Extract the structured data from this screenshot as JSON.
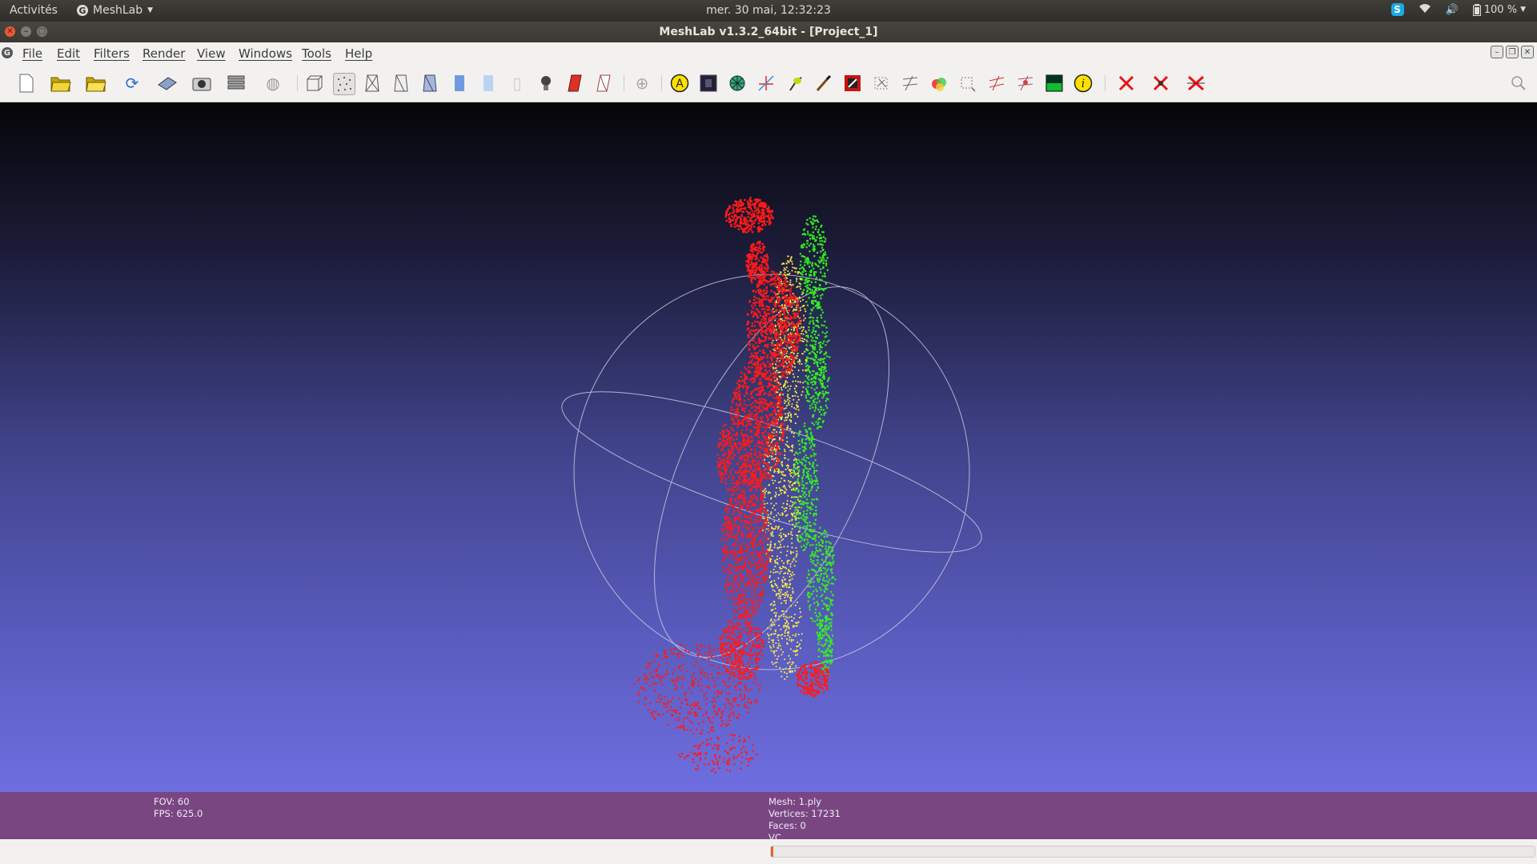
{
  "system_bar": {
    "activities": "Activités",
    "app_name": "MeshLab",
    "clock": "mer. 30 mai, 12:32:23",
    "battery": "100 %"
  },
  "window": {
    "title": "MeshLab v1.3.2_64bit - [Project_1]"
  },
  "menu": [
    "File",
    "Edit",
    "Filters",
    "Render",
    "View",
    "Windows",
    "Tools",
    "Help"
  ],
  "info": {
    "fov": "FOV: 60",
    "fps": "FPS:   625.0",
    "mesh": "Mesh: 1.ply",
    "vertices": "Vertices: 17231",
    "faces": "Faces: 0",
    "vc": "VC"
  },
  "progress_fraction": 0.003,
  "colors": {
    "viewport_top": "#060608",
    "viewport_bottom": "#6e6ee0",
    "info_panel": "#7a4682",
    "points_red": "#ff1a1a",
    "points_green": "#33ee22",
    "points_yellow": "#ffee44",
    "trackball": "#c8c8e0"
  },
  "toolbar_icons": [
    "new-document-icon",
    "open-project-icon",
    "open-folder-icon",
    "reload-icon",
    "save-icon",
    "snapshot-icon",
    "layers-icon",
    "globe-icon",
    "bounding-box-icon",
    "points-icon",
    "wireframe-icon",
    "hidden-lines-icon",
    "flat-lines-icon",
    "flat-icon",
    "smooth-icon",
    "texture-icon",
    "light-icon",
    "fancy-lighting-icon",
    "backface-icon",
    "trackball-icon",
    "annotation-a-icon",
    "raster-icon",
    "measure-mesh-icon",
    "measure-tool-icon",
    "pick-points-icon",
    "paint-icon",
    "texture-paint-icon",
    "select-vertices-icon",
    "select-connected-icon",
    "z-painting-icon",
    "align-icon",
    "manipulate-icon",
    "reference-icon",
    "quality-icon",
    "info-icon",
    "delete-faces-icon",
    "delete-vertices-icon",
    "delete-all-icon"
  ]
}
